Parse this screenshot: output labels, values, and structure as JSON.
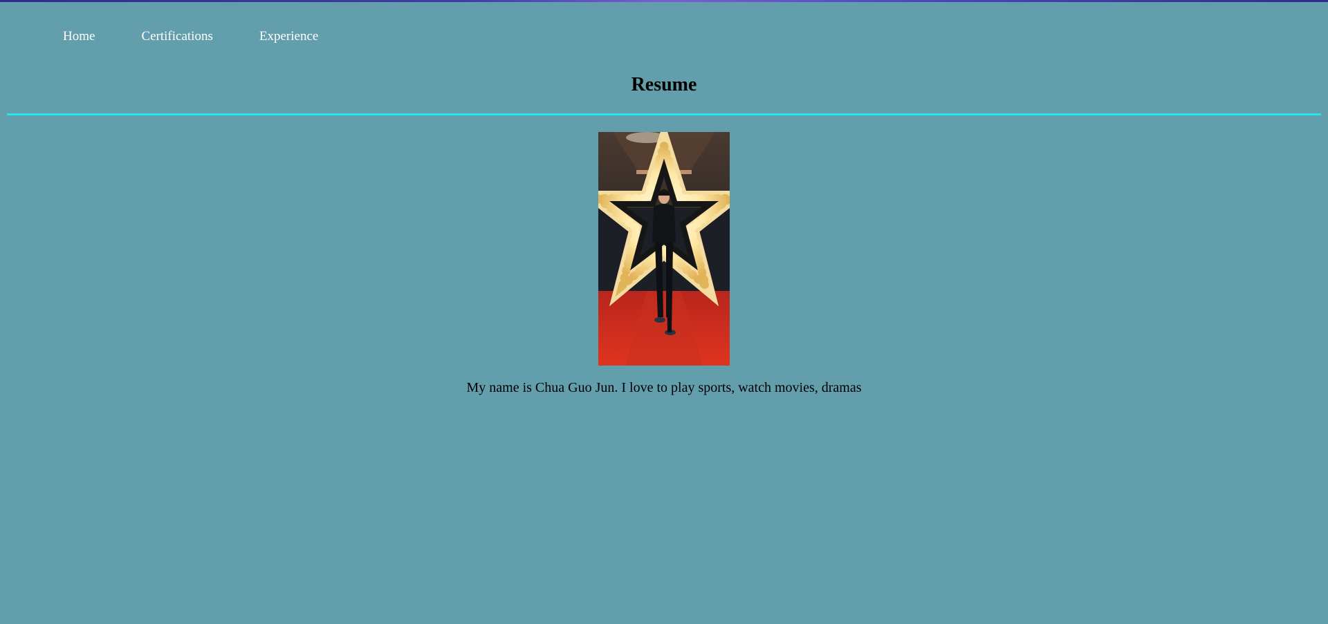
{
  "nav": {
    "items": [
      {
        "label": "Home"
      },
      {
        "label": "Certifications"
      },
      {
        "label": "Experience"
      }
    ]
  },
  "header": {
    "title": "Resume"
  },
  "main": {
    "photo_icon": "profile-photo",
    "bio": "My name is Chua Guo Jun. I love to play sports, watch movies, dramas"
  },
  "colors": {
    "background": "#639eac",
    "divider": "#22e6f0",
    "nav_text": "#ffffff"
  }
}
